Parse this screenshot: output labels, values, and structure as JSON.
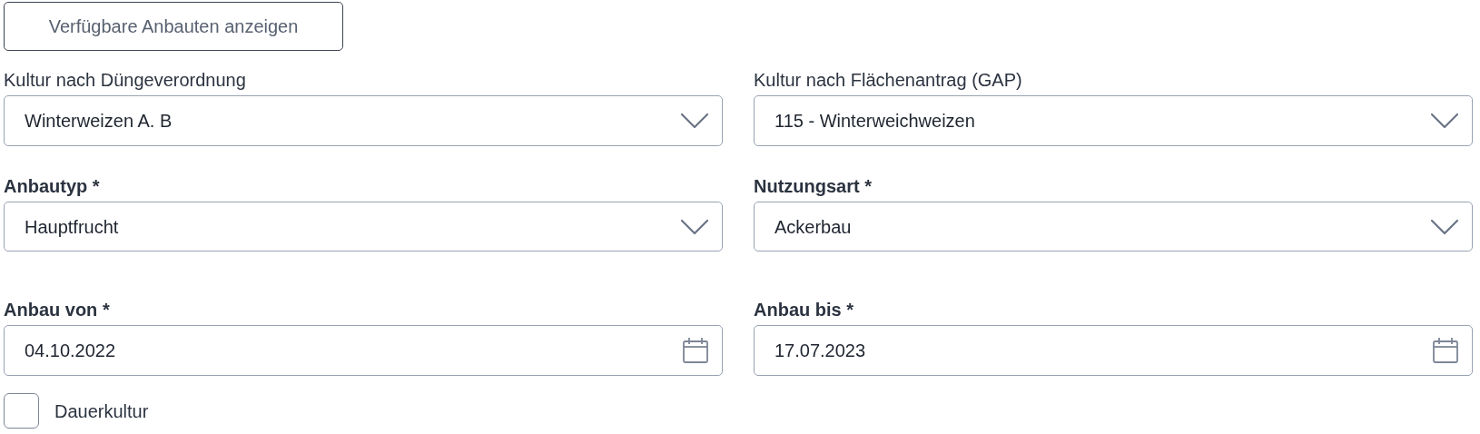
{
  "show_button": {
    "label": "Verfügbare Anbauten anzeigen"
  },
  "rows": [
    [
      {
        "kind": "select",
        "label": "Kultur nach Düngeverordnung",
        "bold": false,
        "value": "Winterweizen A. B"
      },
      {
        "kind": "select",
        "label": "Kultur nach Flächenantrag (GAP)",
        "bold": false,
        "value": "115 - Winterweichweizen"
      }
    ],
    [
      {
        "kind": "select",
        "label": "Anbautyp *",
        "bold": true,
        "value": "Hauptfrucht"
      },
      {
        "kind": "select",
        "label": "Nutzungsart *",
        "bold": true,
        "value": "Ackerbau"
      }
    ],
    [
      {
        "kind": "date",
        "label": "Anbau von *",
        "bold": true,
        "value": "04.10.2022"
      },
      {
        "kind": "date",
        "label": "Anbau bis *",
        "bold": true,
        "value": "17.07.2023"
      }
    ]
  ],
  "permanent_crop": {
    "label": "Dauerkultur",
    "checked": false
  }
}
